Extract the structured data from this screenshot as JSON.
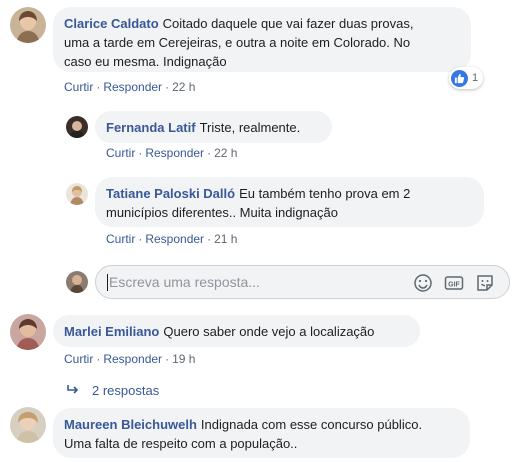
{
  "comments": [
    {
      "author": "Clarice Caldato",
      "line1": "Coitado daquele que vai fazer duas provas,",
      "line2": "uma a tarde em Cerejeiras, e outra a noite em Colorado. No",
      "line3": "caso eu mesma. Indignação",
      "like": "Curtir",
      "reply": "Responder",
      "time": "22 h",
      "reaction_count": "1"
    },
    {
      "author": "Fernanda Latif",
      "line1": "Triste, realmente.",
      "like": "Curtir",
      "reply": "Responder",
      "time": "22 h"
    },
    {
      "author": "Tatiane Paloski Dalló",
      "line1": "Eu também tenho prova em 2",
      "line2": "municípios diferentes.. Muita indignação",
      "like": "Curtir",
      "reply": "Responder",
      "time": "21 h"
    },
    {
      "author": "Marlei Emiliano",
      "line1": "Quero saber onde vejo a localização",
      "like": "Curtir",
      "reply": "Responder",
      "time": "19 h"
    },
    {
      "author": "Maureen Bleichuwelh",
      "line1": "Indignada com esse concurso público.",
      "line2": "Uma falta de respeito com a população.."
    }
  ],
  "reply_input": {
    "placeholder": "Escreva uma resposta..."
  },
  "more_replies": "2 respostas",
  "icons": [
    "like-icon",
    "emoji-icon",
    "gif-icon",
    "sticker-icon",
    "reply-arrow-icon"
  ],
  "colors": {
    "name": "#385898",
    "bubble": "#f2f3f5",
    "like_blue": "#3578e5",
    "meta": "#616770"
  }
}
